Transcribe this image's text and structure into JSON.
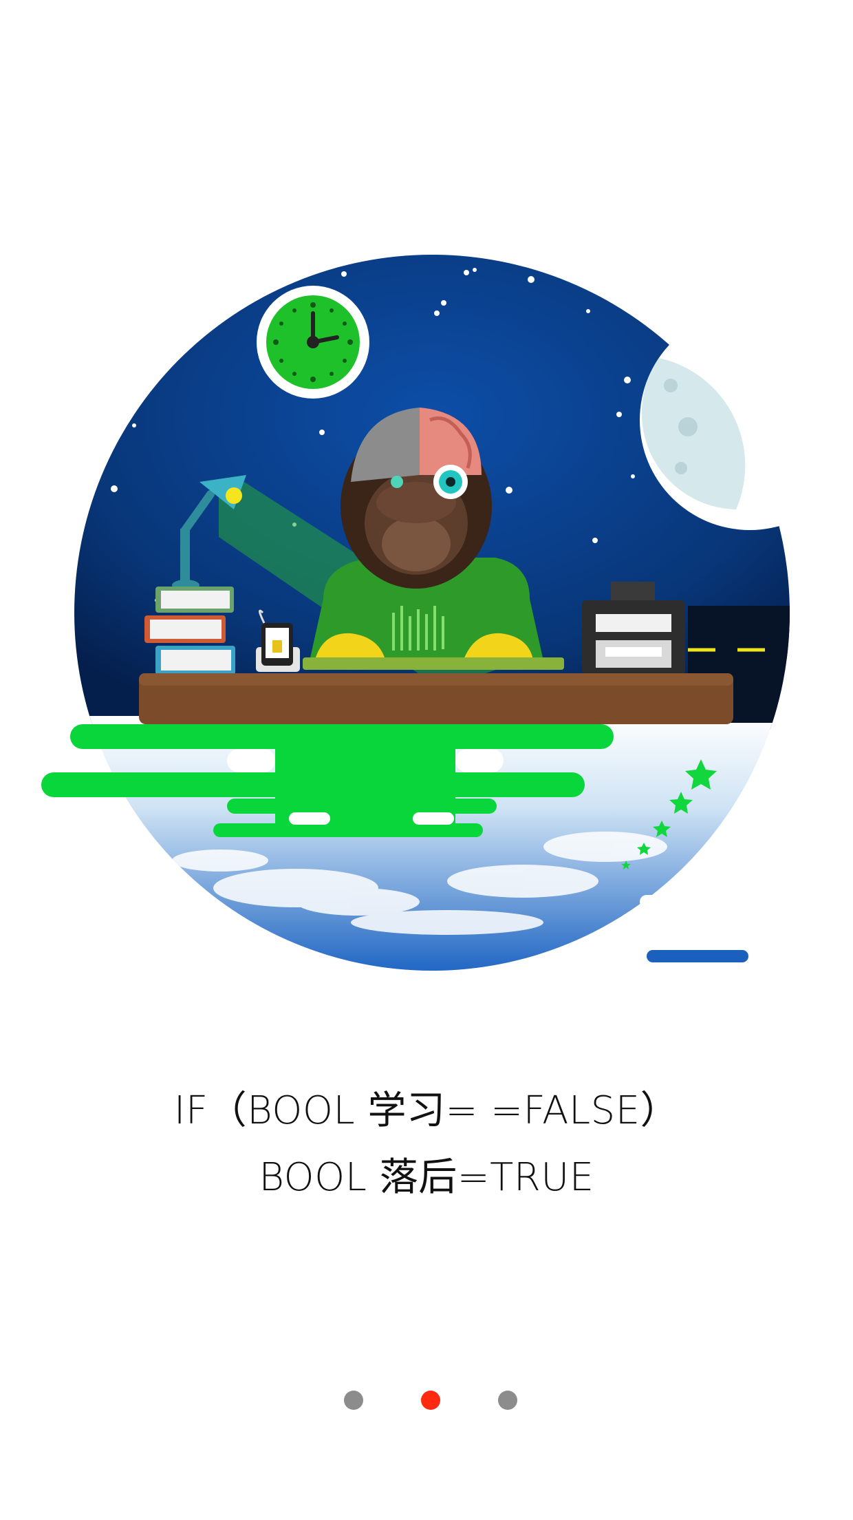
{
  "illustration": {
    "scene": "monkey-coder-at-desk",
    "colors": {
      "sky": "#0a3d8a",
      "sky_dark": "#062658",
      "green": "#08d63a",
      "desk": "#7b4b2a",
      "cloud_blue": "#1d67c8",
      "moon": "#d9ecef"
    }
  },
  "caption": {
    "line1": "IF（BOOL 学习= =FALSE）",
    "line2": "BOOL 落后=TRUE"
  },
  "pager": {
    "pages": 3,
    "current_index": 1,
    "active_color": "#ff2a10",
    "inactive_color": "#8c8c8c"
  }
}
